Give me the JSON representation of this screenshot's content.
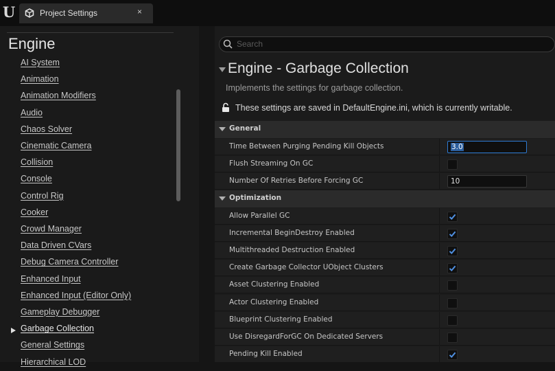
{
  "window": {
    "tab_title": "Project Settings",
    "close_glyph": "×",
    "logo_glyph": "U"
  },
  "sidebar": {
    "section_title": "Engine",
    "items": [
      {
        "label": "AI System",
        "active": false
      },
      {
        "label": "Animation",
        "active": false
      },
      {
        "label": "Animation Modifiers",
        "active": false
      },
      {
        "label": "Audio",
        "active": false
      },
      {
        "label": "Chaos Solver",
        "active": false
      },
      {
        "label": "Cinematic Camera",
        "active": false
      },
      {
        "label": "Collision",
        "active": false
      },
      {
        "label": "Console",
        "active": false
      },
      {
        "label": "Control Rig",
        "active": false
      },
      {
        "label": "Cooker",
        "active": false
      },
      {
        "label": "Crowd Manager",
        "active": false
      },
      {
        "label": "Data Driven CVars",
        "active": false
      },
      {
        "label": "Debug Camera Controller",
        "active": false
      },
      {
        "label": "Enhanced Input",
        "active": false
      },
      {
        "label": "Enhanced Input (Editor Only)",
        "active": false
      },
      {
        "label": "Gameplay Debugger",
        "active": false
      },
      {
        "label": "Garbage Collection",
        "active": true
      },
      {
        "label": "General Settings",
        "active": false
      },
      {
        "label": "Hierarchical LOD",
        "active": false
      }
    ]
  },
  "search": {
    "placeholder": "Search"
  },
  "category": {
    "title": "Engine - Garbage Collection",
    "description": "Implements the settings for garbage collection.",
    "saved_note": "These settings are saved in DefaultEngine.ini, which is currently writable."
  },
  "groups": {
    "general": {
      "label": "General",
      "props": [
        {
          "label": "Time Between Purging Pending Kill Objects",
          "type": "number",
          "value": "3.0",
          "focused": true
        },
        {
          "label": "Flush Streaming On GC",
          "type": "bool",
          "checked": false
        },
        {
          "label": "Number Of Retries Before Forcing GC",
          "type": "number",
          "value": "10",
          "focused": false
        }
      ]
    },
    "optimization": {
      "label": "Optimization",
      "props": [
        {
          "label": "Allow Parallel GC",
          "type": "bool",
          "checked": true
        },
        {
          "label": "Incremental BeginDestroy Enabled",
          "type": "bool",
          "checked": true
        },
        {
          "label": "Multithreaded Destruction Enabled",
          "type": "bool",
          "checked": true
        },
        {
          "label": "Create Garbage Collector UObject Clusters",
          "type": "bool",
          "checked": true
        },
        {
          "label": "Asset Clustering Enabled",
          "type": "bool",
          "checked": false
        },
        {
          "label": "Actor Clustering Enabled",
          "type": "bool",
          "checked": false
        },
        {
          "label": "Blueprint Clustering Enabled",
          "type": "bool",
          "checked": false
        },
        {
          "label": "Use DisregardForGC On Dedicated Servers",
          "type": "bool",
          "checked": false
        },
        {
          "label": "Pending Kill Enabled",
          "type": "bool",
          "checked": true
        }
      ]
    }
  },
  "colors": {
    "accent": "#2e7bd3",
    "check": "#4f8fe0"
  }
}
